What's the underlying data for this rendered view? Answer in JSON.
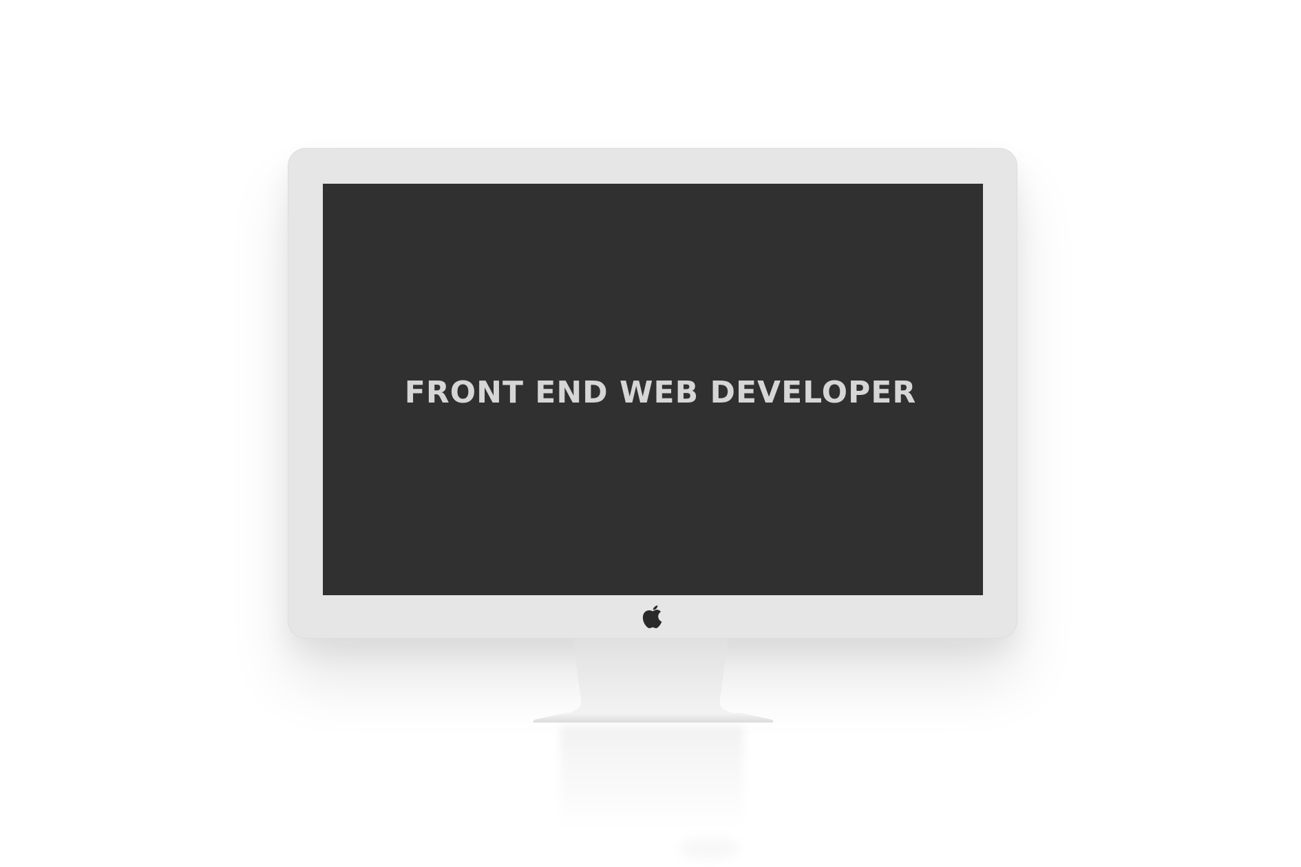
{
  "screen": {
    "headline": "FRONT END WEB DEVELOPER"
  },
  "colors": {
    "background": "#ffffff",
    "bezel": "#e6e6e6",
    "screen": "#303030",
    "headline_text": "#d6d6d6",
    "logo": "#2a2a2a"
  },
  "icons": {
    "brand_logo": "apple-logo-icon"
  }
}
